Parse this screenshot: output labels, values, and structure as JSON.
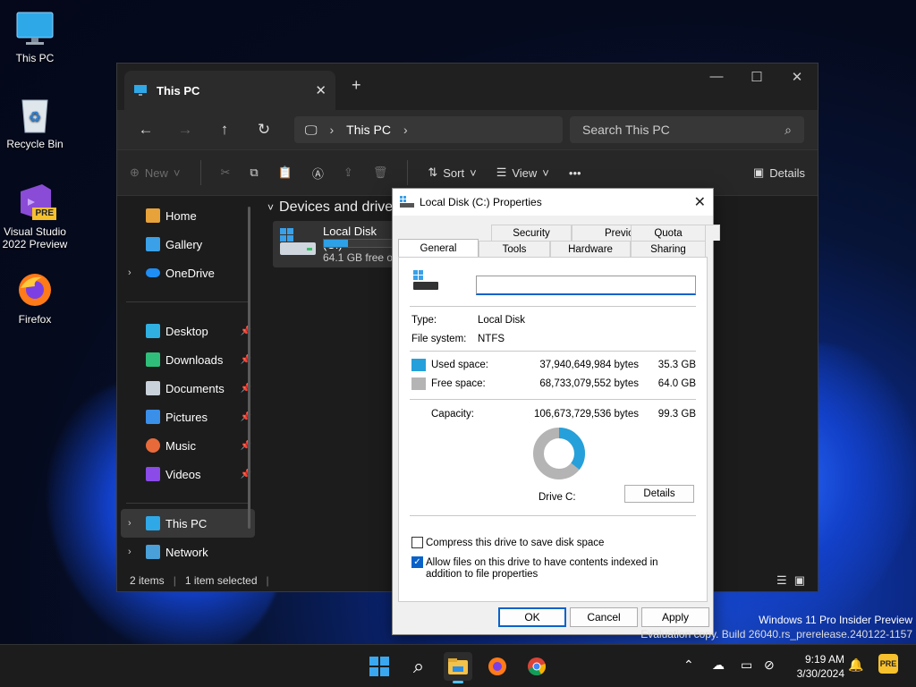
{
  "desktop": {
    "icons": [
      {
        "label": "This PC"
      },
      {
        "label": "Recycle Bin"
      },
      {
        "label": "Visual Studio 2022 Preview",
        "badge": "PRE"
      },
      {
        "label": "Firefox"
      }
    ]
  },
  "explorer": {
    "tab_title": "This PC",
    "new_tab": "+",
    "address": {
      "location": "This PC"
    },
    "search_placeholder": "Search This PC",
    "toolbar": {
      "new_label": "New",
      "sort_label": "Sort",
      "view_label": "View",
      "more_label": "•••",
      "details_label": "Details"
    },
    "nav": {
      "items": [
        {
          "label": "Home"
        },
        {
          "label": "Gallery"
        },
        {
          "label": "OneDrive"
        }
      ],
      "quick": [
        {
          "label": "Desktop"
        },
        {
          "label": "Downloads"
        },
        {
          "label": "Documents"
        },
        {
          "label": "Pictures"
        },
        {
          "label": "Music"
        },
        {
          "label": "Videos"
        }
      ],
      "bottom": [
        {
          "label": "This PC"
        },
        {
          "label": "Network"
        }
      ]
    },
    "section_header": "Devices and drives",
    "drive": {
      "name": "Local Disk (C:)",
      "free_text": "64.1 GB free of",
      "used_fraction": 0.36
    },
    "status": {
      "items": "2 items",
      "selected": "1 item selected"
    }
  },
  "dialog": {
    "title": "Local Disk (C:) Properties",
    "tabs_row1": [
      "Security",
      "Previous Versions",
      "Quota"
    ],
    "tabs_row2": [
      "General",
      "Tools",
      "Hardware",
      "Sharing"
    ],
    "active_tab": "General",
    "name_value": "",
    "type_label": "Type:",
    "type_value": "Local Disk",
    "fs_label": "File system:",
    "fs_value": "NTFS",
    "used_label": "Used space:",
    "used_bytes": "37,940,649,984 bytes",
    "used_gb": "35.3 GB",
    "free_label": "Free space:",
    "free_bytes": "68,733,079,552 bytes",
    "free_gb": "64.0 GB",
    "cap_label": "Capacity:",
    "cap_bytes": "106,673,729,536 bytes",
    "cap_gb": "99.3 GB",
    "drive_label": "Drive C:",
    "details_button": "Details",
    "compress_label": "Compress this drive to save disk space",
    "index_label": "Allow files on this drive to have contents indexed in addition to file properties",
    "ok": "OK",
    "cancel": "Cancel",
    "apply": "Apply",
    "colors": {
      "used": "#26a0da",
      "free": "#b4b4b4"
    },
    "used_fraction": 0.356
  },
  "watermark": {
    "line1": "Windows 11 Pro Insider Preview",
    "line2": "Evaluation copy. Build 26040.rs_prerelease.240122-1157"
  },
  "taskbar": {
    "time": "9:19 AM",
    "date": "3/30/2024"
  }
}
